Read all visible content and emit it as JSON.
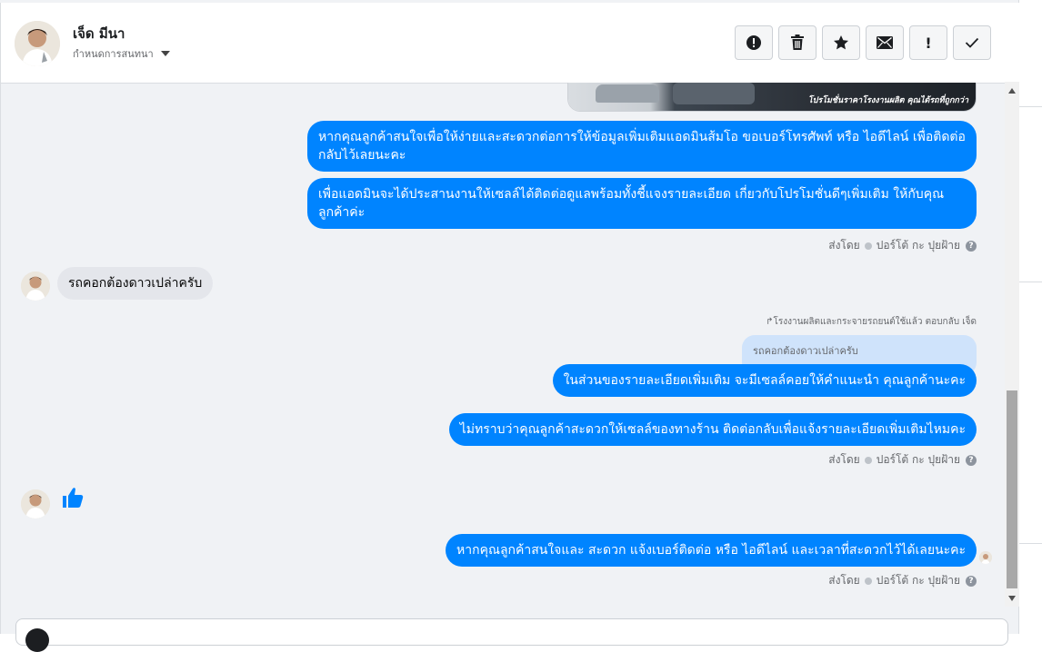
{
  "header": {
    "contact_name": "เจ็ด มีนา",
    "assign_label": "กำหนดการสนทนา",
    "tools": [
      "spam-icon",
      "trash-icon",
      "star-icon",
      "envelope-icon",
      "mark-important-icon",
      "check-icon"
    ],
    "mark_label": "!"
  },
  "banner": {
    "caption": "โปรโมชั่นราคาโรงงานผลิต คุณได้รถที่ถูกกว่า"
  },
  "messages": {
    "m1": "หากคุณลูกค้าสนใจเพื่อให้ง่ายและสะดวกต่อการให้ข้อมูลเพิ่มเติมแอดมินส้มโอ ขอเบอร์โทรศัพท์ หรือ ไอดีไลน์ เพื่อติดต่อกลับไว้เลยนะคะ",
    "m2": "เพื่อแอดมินจะได้ประสานงานให้เซลล์ได้ติดต่อดูแลพร้อมทั้งชี้แจงรายละเอียด เกี่ยวกับโปรโมชั่นดีๆเพิ่มเติม ให้กับคุณลูกค้าค่ะ",
    "m3": "รถคอกต้องดาวเปล่าครับ",
    "reply_note": "โรงงานผลิตและกระจายรถยนต์ใช้แล้ว ตอบกลับ เจ็ด",
    "quote": "รถคอกต้องดาวเปล่าครับ",
    "m4": "ในส่วนของรายละเอียดเพิ่มเติม จะมีเซลล์คอยให้คำแนะนำ คุณลูกค้านะคะ",
    "m5": "ไม่ทราบว่าคุณลูกค้าสะดวกให้เซลล์ของทางร้าน ติดต่อกลับเพื่อแจ้งรายละเอียดเพิ่มเติมไหมคะ",
    "m6": "หากคุณลูกค้าสนใจและ สะดวก แจ้งเบอร์ติดต่อ หรือ ไอดีไลน์ และเวลาที่สะดวกไว้ได้เลยนะคะ"
  },
  "sent_by": {
    "prefix": "ส่งโดย",
    "agent": "ปอร์โต้ กะ ปุยฝ้าย",
    "help": "?"
  },
  "colors": {
    "outgoing": "#0084ff",
    "incoming": "#e4e6eb",
    "like": "#0084ff"
  }
}
